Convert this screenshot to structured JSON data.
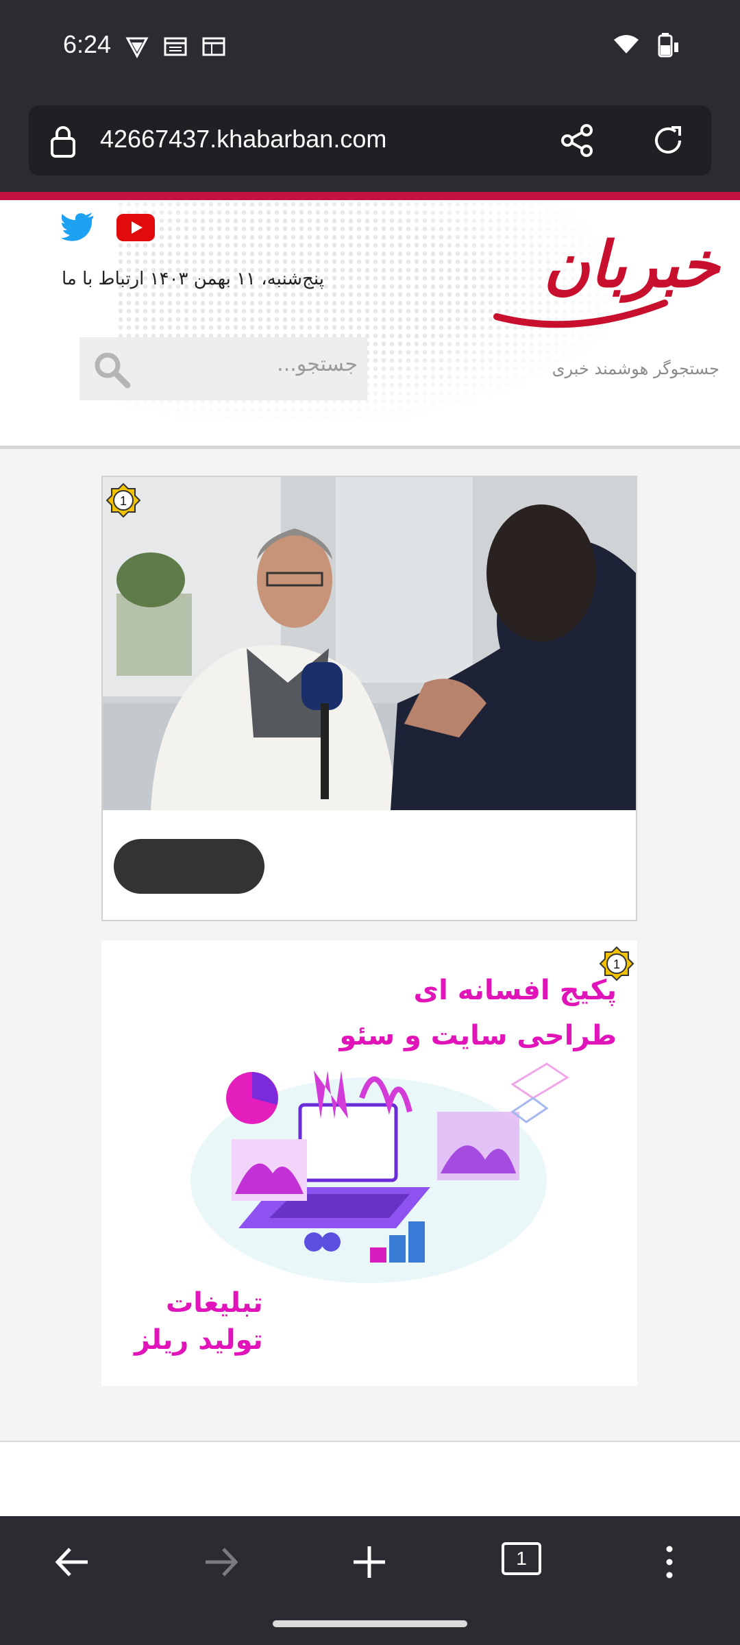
{
  "status_bar": {
    "time": "6:24"
  },
  "browser": {
    "url": "42667437.khabarban.com",
    "tab_count": "1"
  },
  "site": {
    "logo_text": "خبربان",
    "tagline": "جستجوگر هوشمند خبری",
    "date_line": "پنج‌شنبه، ۱۱ بهمن ۱۴۰۳  ارتباط با ما",
    "search_placeholder": "جستجو..."
  },
  "badges": {
    "card1": "1",
    "card2": "1"
  },
  "ad": {
    "headline_1": "پکیج افسانه ای",
    "headline_2": "طراحی سایت و سئو",
    "footer_1": "تبلیغات",
    "footer_2": "تولید ریلز"
  },
  "colors": {
    "brand_red": "#c51341",
    "ad_pink": "#e014b8",
    "chrome_dark": "#2b2c31"
  }
}
